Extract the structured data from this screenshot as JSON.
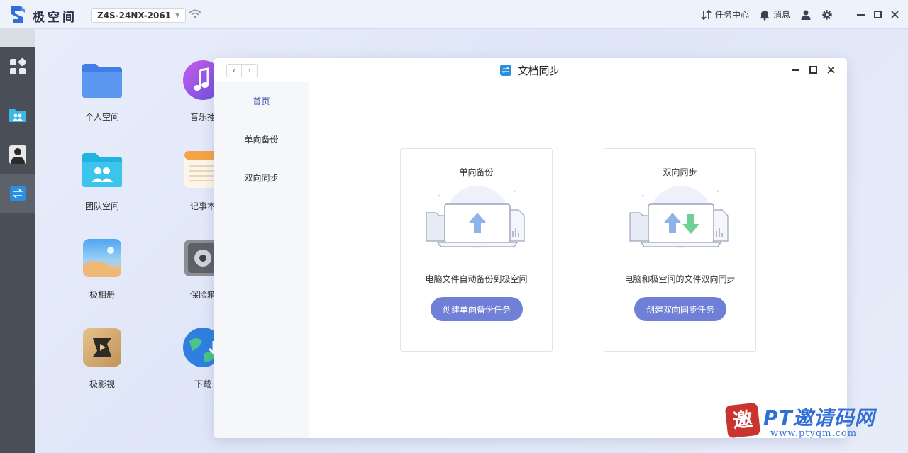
{
  "topbar": {
    "brand": "极空间",
    "device": "Z4S-24NX-2061",
    "task_center": "任务中心",
    "messages": "消息"
  },
  "desktop": {
    "icons": [
      {
        "label": "个人空间",
        "icon": "folder-icon"
      },
      {
        "label": "音乐播",
        "icon": "music-icon"
      },
      {
        "label": "团队空间",
        "icon": "team-folder-icon"
      },
      {
        "label": "记事本",
        "icon": "notepad-icon"
      },
      {
        "label": "极相册",
        "icon": "photo-album-icon"
      },
      {
        "label": "保险箱",
        "icon": "safe-icon"
      },
      {
        "label": "极影视",
        "icon": "video-icon"
      },
      {
        "label": "下载",
        "icon": "download-icon"
      }
    ]
  },
  "window": {
    "title": "文档同步",
    "sidebar": [
      {
        "label": "首页",
        "active": true
      },
      {
        "label": "单向备份",
        "active": false
      },
      {
        "label": "双向同步",
        "active": false
      }
    ],
    "cards": [
      {
        "title": "单向备份",
        "description": "电脑文件自动备份到极空间",
        "button": "创建单向备份任务"
      },
      {
        "title": "双向同步",
        "description": "电脑和极空间的文件双向同步",
        "button": "创建双向同步任务"
      }
    ]
  },
  "watermark": {
    "badge": "邀",
    "text": "PT邀请码网",
    "url": "www.ptyqm.com"
  },
  "colors": {
    "accent": "#6f80d6",
    "dock": "#4a4f57",
    "arrow_up": "#8fb3e8",
    "arrow_down": "#6fcf97"
  }
}
